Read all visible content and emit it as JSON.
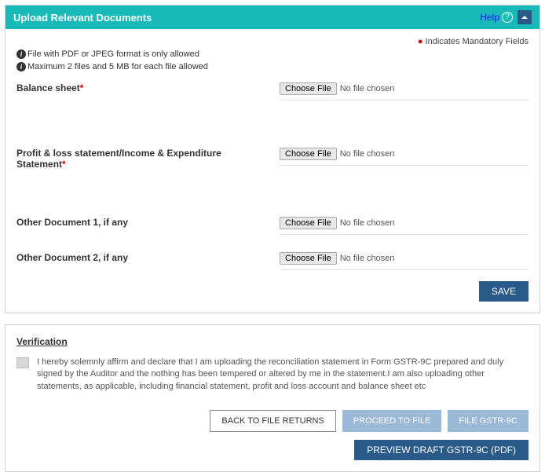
{
  "header": {
    "title": "Upload Relevant Documents",
    "help_label": "Help"
  },
  "mandatory_note": "Indicates Mandatory Fields",
  "info": {
    "line1": "File with PDF or JPEG format is only allowed",
    "line2": "Maximum 2 files and 5 MB for each file allowed"
  },
  "fields": {
    "balance_sheet": {
      "label": "Balance sheet",
      "required": true,
      "choose_label": "Choose File",
      "status": "No file chosen"
    },
    "profit_loss": {
      "label": "Profit & loss statement/Income & Expenditure Statement",
      "required": true,
      "choose_label": "Choose File",
      "status": "No file chosen"
    },
    "other1": {
      "label": "Other Document 1, if any",
      "required": false,
      "choose_label": "Choose File",
      "status": "No file chosen"
    },
    "other2": {
      "label": "Other Document 2, if any",
      "required": false,
      "choose_label": "Choose File",
      "status": "No file chosen"
    }
  },
  "save_label": "SAVE",
  "verification": {
    "title": "Verification",
    "text": "I hereby solemnly affirm and declare that I am uploading the reconciliation statement in Form GSTR-9C prepared and duly signed by the Auditor and the nothing has been tempered or altered by me in the statement.I am also uploading other statements, as applicable, including financial statement, profit and loss account and balance sheet etc"
  },
  "actions": {
    "back": "BACK TO FILE RETURNS",
    "proceed": "PROCEED TO FILE",
    "file": "FILE GSTR-9C",
    "preview": "PREVIEW DRAFT GSTR-9C (PDF)"
  }
}
